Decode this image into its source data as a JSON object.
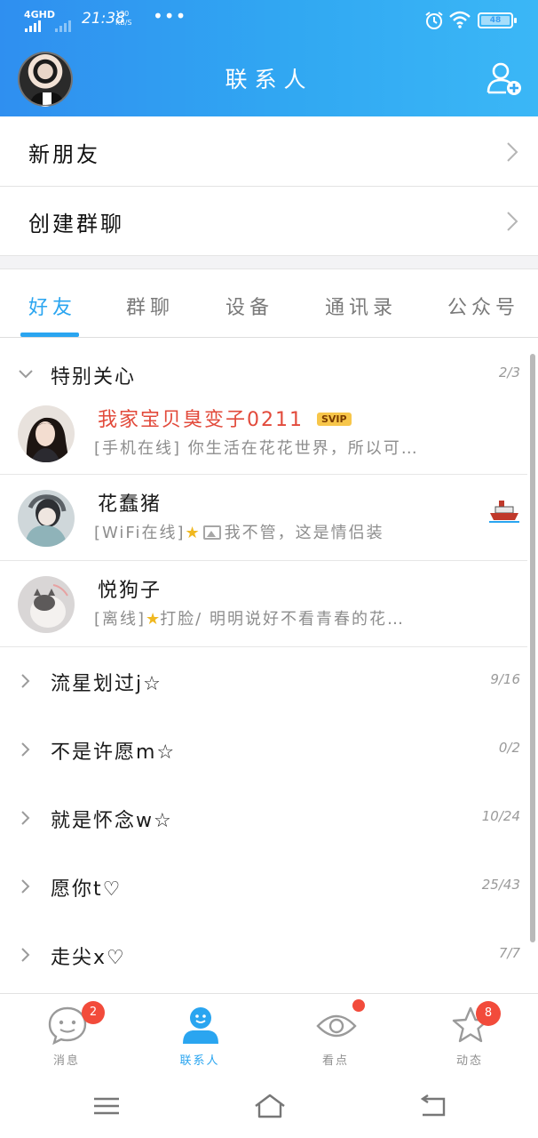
{
  "status_bar": {
    "network": "4GHD",
    "time": "21:38",
    "speed_value": "130",
    "speed_unit": "KB/S",
    "battery": "48"
  },
  "header": {
    "title": "联系人"
  },
  "entries": [
    {
      "label": "新朋友"
    },
    {
      "label": "创建群聊"
    }
  ],
  "tabs": [
    {
      "label": "好友",
      "active": true
    },
    {
      "label": "群聊"
    },
    {
      "label": "设备"
    },
    {
      "label": "通讯录"
    },
    {
      "label": "公众号"
    }
  ],
  "special_group": {
    "name": "特别关心",
    "count": "2/3",
    "friends": [
      {
        "name": "我家宝贝臭变子0211",
        "badge": "SVIP",
        "status_prefix": "[手机在线]",
        "message": "你生活在花花世界，所以可…"
      },
      {
        "name": "花蠢猪",
        "status_prefix": "[WiFi在线]",
        "message": "我不管，这是情侣装"
      },
      {
        "name": "悦狗子",
        "status_prefix": "[离线]",
        "message": "打脸/ 明明说好不看青春的花…"
      }
    ]
  },
  "groups": [
    {
      "name": "流星划过j☆",
      "count": "9/16"
    },
    {
      "name": "不是许愿m☆",
      "count": "0/2"
    },
    {
      "name": "就是怀念w☆",
      "count": "10/24"
    },
    {
      "name": "愿你t♡",
      "count": "25/43"
    },
    {
      "name": "走尖x♡",
      "count": "7/7"
    }
  ],
  "bottom_nav": [
    {
      "label": "消息",
      "badge": "2"
    },
    {
      "label": "联系人",
      "active": true
    },
    {
      "label": "看点"
    },
    {
      "label": "动态",
      "badge": "8"
    }
  ],
  "colors": {
    "brand": "#2aa5f0",
    "badge": "#f24b3b",
    "special_name": "#e24a3b"
  }
}
